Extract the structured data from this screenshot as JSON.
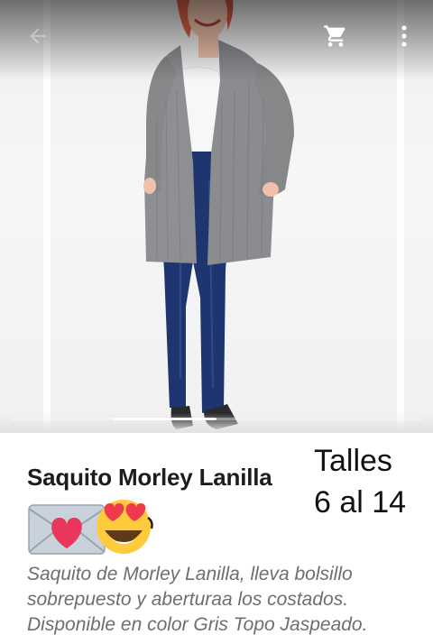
{
  "appbar": {
    "back_icon": "arrow-back-icon",
    "cart_icon": "shopping-cart-icon",
    "more_icon": "more-vert-icon"
  },
  "product": {
    "title": "Saquito Morley Lanilla",
    "sizes_label": "Talles",
    "sizes_range": "6 al 14",
    "emojis": [
      "love-letter-emoji",
      "heart-eyes-emoji"
    ],
    "description_lines": [
      "Saquito de Morley Lanilla, lleva bolsillo",
      "sobrepuesto y aberturaa los costados.",
      "Disponible en color Gris Topo Jaspeado."
    ]
  },
  "gallery": {
    "image_subject": "product-photo",
    "current_index": 2,
    "total": 4
  },
  "colors": {
    "title": "#1d1d1d",
    "description": "#6b6e72",
    "icon": "#ffffff"
  }
}
